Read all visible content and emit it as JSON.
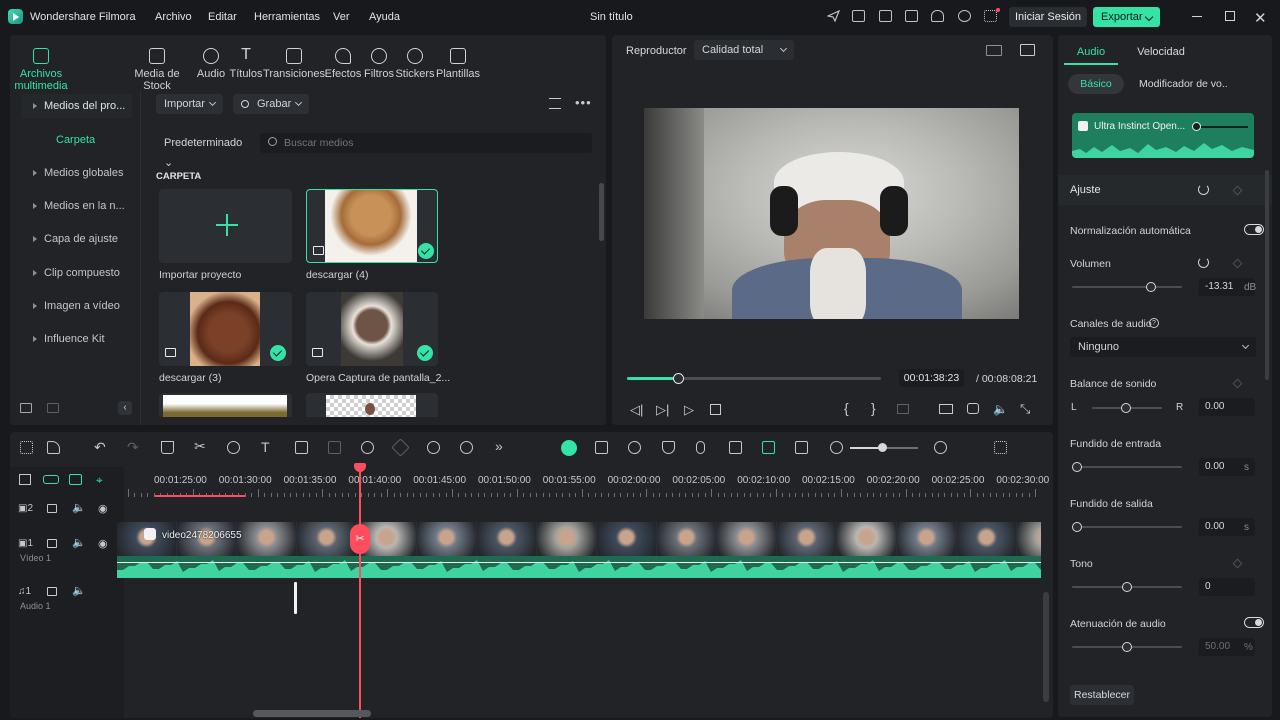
{
  "app": {
    "name": "Wondershare Filmora",
    "doc_title": "Sin título"
  },
  "menu": [
    "Archivo",
    "Editar",
    "Herramientas",
    "Ver",
    "Ayuda"
  ],
  "header": {
    "login": "Iniciar Sesión",
    "export": "Exportar"
  },
  "toolbar": [
    "Archivos multimedia",
    "Media de Stock",
    "Audio",
    "Títulos",
    "Transiciones",
    "Efectos",
    "Filtros",
    "Stickers",
    "Plantillas"
  ],
  "sidebar": {
    "project_media": "Medios del pro...",
    "folder": "Carpeta",
    "items": [
      "Medios globales",
      "Medios en la n...",
      "Capa de ajuste",
      "Clip compuesto",
      "Imagen a vídeo",
      "Influence Kit"
    ]
  },
  "media": {
    "import": "Importar",
    "record": "Grabar",
    "sort": "Predeterminado",
    "search_placeholder": "Buscar medios",
    "section": "CARPETA",
    "items": [
      "Importar proyecto",
      "descargar (4)",
      "descargar (3)",
      "Opera Captura de pantalla_2..."
    ]
  },
  "player": {
    "label": "Reproductor",
    "quality": "Calidad total",
    "current_time": "00:01:38:23",
    "total_time": "/ 00:08:08:21",
    "progress": 0.2,
    "brace_open": "{",
    "brace_close": "}"
  },
  "props": {
    "tabs": [
      "Audio",
      "Velocidad"
    ],
    "subtabs": [
      "Básico",
      "Modificador de vo..."
    ],
    "track_name": "Ultra Instinct Open...",
    "ajuste": "Ajuste",
    "auto_norm": "Normalización automática",
    "volume": {
      "label": "Volumen",
      "value": "-13.31",
      "unit": "dB"
    },
    "channels": {
      "label": "Canales de audio",
      "value": "Ninguno"
    },
    "balance": {
      "label": "Balance de sonido",
      "left": "L",
      "right": "R",
      "value": "0.00"
    },
    "fade_in": {
      "label": "Fundido de entrada",
      "value": "0.00",
      "unit": "s"
    },
    "fade_out": {
      "label": "Fundido  de salida",
      "value": "0.00",
      "unit": "s"
    },
    "tone": {
      "label": "Tono",
      "value": "0"
    },
    "ducking": {
      "label": "Atenuación de audio",
      "value": "50.00",
      "unit": "%"
    },
    "reset": "Restablecer"
  },
  "timeline": {
    "ruler": [
      "00:01:25:00",
      "00:01:30:00",
      "00:01:35:00",
      "00:01:40:00",
      "00:01:45:00",
      "00:01:50:00",
      "00:01:55:00",
      "00:02:00:00",
      "00:02:05:00",
      "00:02:10:00",
      "00:02:15:00",
      "00:02:20:00",
      "00:02:25:00",
      "00:02:30:00"
    ],
    "tracks": [
      {
        "num": "2",
        "label": ""
      },
      {
        "num": "1",
        "label": "Vídeo 1"
      },
      {
        "num": "1",
        "label": "Audio 1"
      }
    ],
    "clip_name": "video2478206655"
  },
  "colors": {
    "accent": "#35e3a6",
    "playhead": "#ff4d5e",
    "panel": "#212326",
    "bg": "#17191c"
  }
}
